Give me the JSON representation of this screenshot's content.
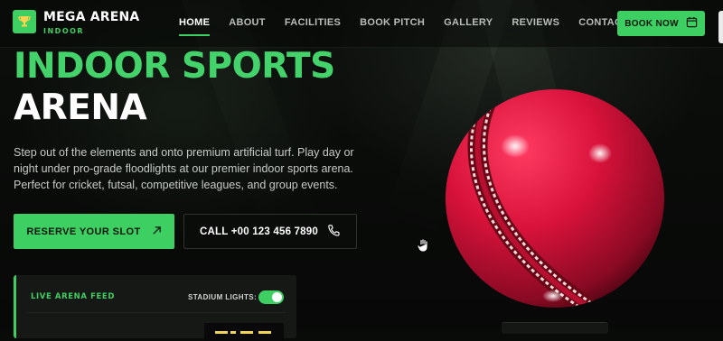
{
  "brand": {
    "name": "MEGA ARENA",
    "tagline": "INDOOR",
    "icon": "trophy-icon",
    "color": "#3ecf62"
  },
  "nav": {
    "items": [
      {
        "label": "HOME",
        "active": true
      },
      {
        "label": "ABOUT",
        "active": false
      },
      {
        "label": "FACILITIES",
        "active": false
      },
      {
        "label": "BOOK PITCH",
        "active": false
      },
      {
        "label": "GALLERY",
        "active": false
      },
      {
        "label": "REVIEWS",
        "active": false
      },
      {
        "label": "CONTACT",
        "active": false
      }
    ],
    "cta_label": "BOOK NOW",
    "cta_icon": "calendar-icon"
  },
  "hero": {
    "title_line1": "INDOOR SPORTS",
    "title_line2": "ARENA",
    "description": "Step out of the elements and onto premium artificial turf. Play day or night under pro-grade floodlights at our premier indoor sports arena. Perfect for cricket, futsal, competitive leagues, and group events.",
    "primary_button": "RESERVE YOUR SLOT",
    "primary_icon": "arrow-up-right-icon",
    "secondary_button": "CALL +00 123 456 7890",
    "secondary_icon": "phone-icon"
  },
  "feed": {
    "title": "LIVE ARENA FEED",
    "lights_label": "STADIUM LIGHTS:",
    "lights_on": true
  },
  "colors": {
    "accent": "#3ecf62",
    "background": "#090b09",
    "ball": "#d8123a",
    "scoreboard_text": "#f2d35c"
  }
}
